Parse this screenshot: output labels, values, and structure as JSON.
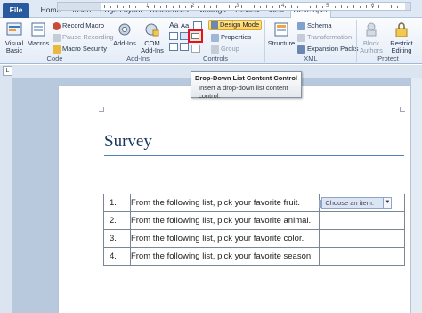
{
  "tabs": [
    "File",
    "Home",
    "Insert",
    "Page Layout",
    "References",
    "Mailings",
    "Review",
    "View",
    "Developer"
  ],
  "active_tab": "Developer",
  "ribbon": {
    "code": {
      "label": "Code",
      "visual_basic": "Visual Basic",
      "macros": "Macros",
      "record_macro": "Record Macro",
      "pause_recording": "Pause Recording",
      "macro_security": "Macro Security"
    },
    "addins": {
      "label": "Add-Ins",
      "add_ins": "Add-Ins",
      "com_add_ins": "COM Add-Ins"
    },
    "controls": {
      "label": "Controls",
      "aa1": "Aa",
      "aa2": "Aa",
      "design_mode": "Design Mode",
      "properties": "Properties",
      "group": "Group"
    },
    "xml": {
      "label": "XML",
      "structure": "Structure",
      "schema": "Schema",
      "transformation": "Transformation",
      "expansion_packs": "Expansion Packs"
    },
    "protect": {
      "label": "Protect",
      "block_authors": "Block Authors",
      "restrict_editing": "Restrict Editing"
    }
  },
  "ruler_numbers": [
    "1",
    "2",
    "3",
    "4",
    "5",
    "6"
  ],
  "tab_selector": "L",
  "tooltip": {
    "title": "Drop-Down List Content Control",
    "body": "Insert a drop-down list content control."
  },
  "document": {
    "title": "Survey",
    "rows": [
      {
        "num": "1.",
        "question": "From the following list, pick your favorite fruit."
      },
      {
        "num": "2.",
        "question": "From the following list, pick your favorite animal."
      },
      {
        "num": "3.",
        "question": "From the following list, pick your favorite color."
      },
      {
        "num": "4.",
        "question": "From the following list, pick your favorite season."
      }
    ],
    "dropdown_text": "Choose an item.",
    "dropdown_arrow": "▼"
  },
  "colors": {
    "file_tab": "#2a5a9e",
    "design_mode_active": "#ffcf5a",
    "title_color": "#17365d",
    "highlight_border": "#e0112a"
  }
}
